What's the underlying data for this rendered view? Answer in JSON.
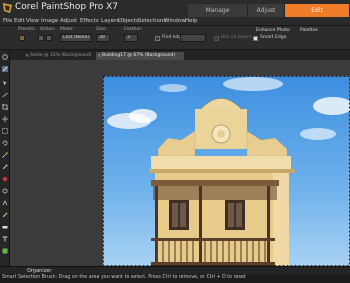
{
  "app": {
    "title": "Corel PaintShop Pro X7",
    "workspace_tabs": [
      "Manage",
      "Adjust",
      "Edit"
    ],
    "active_workspace": "Edit",
    "accent_color": "#f07c27"
  },
  "menu": [
    "File",
    "Edit",
    "View",
    "Image",
    "Adjust",
    "Effects",
    "Layers",
    "Objects",
    "Selections",
    "Window",
    "Help"
  ],
  "options": {
    "labels": {
      "presets": "Presets:",
      "action": "Action:",
      "mode": "Mode:",
      "size": "Size:",
      "feather": "Feather:"
    },
    "mode_value": "Last (None)",
    "size_value": "30",
    "feather_value": "3",
    "find_edge": "Find edge",
    "use_all_layers": "Use all layers",
    "smart_edge": "Smart Edge",
    "enhance_photo": "Enhance Photo",
    "palettes": "Palettes"
  },
  "doc_tabs": [
    "Smile @ 33% (Background)",
    "Building17 @ 67% (Background)"
  ],
  "organizer_label": "Organizer",
  "status": "Smart Selection Brush: Drag on the area you want to select. Press Ctrl to remove, or Ctrl + D to reset",
  "icons": [
    "app-logo-icon",
    "presets-icon",
    "action-icon",
    "tool-icons",
    "tab-close-icon"
  ]
}
